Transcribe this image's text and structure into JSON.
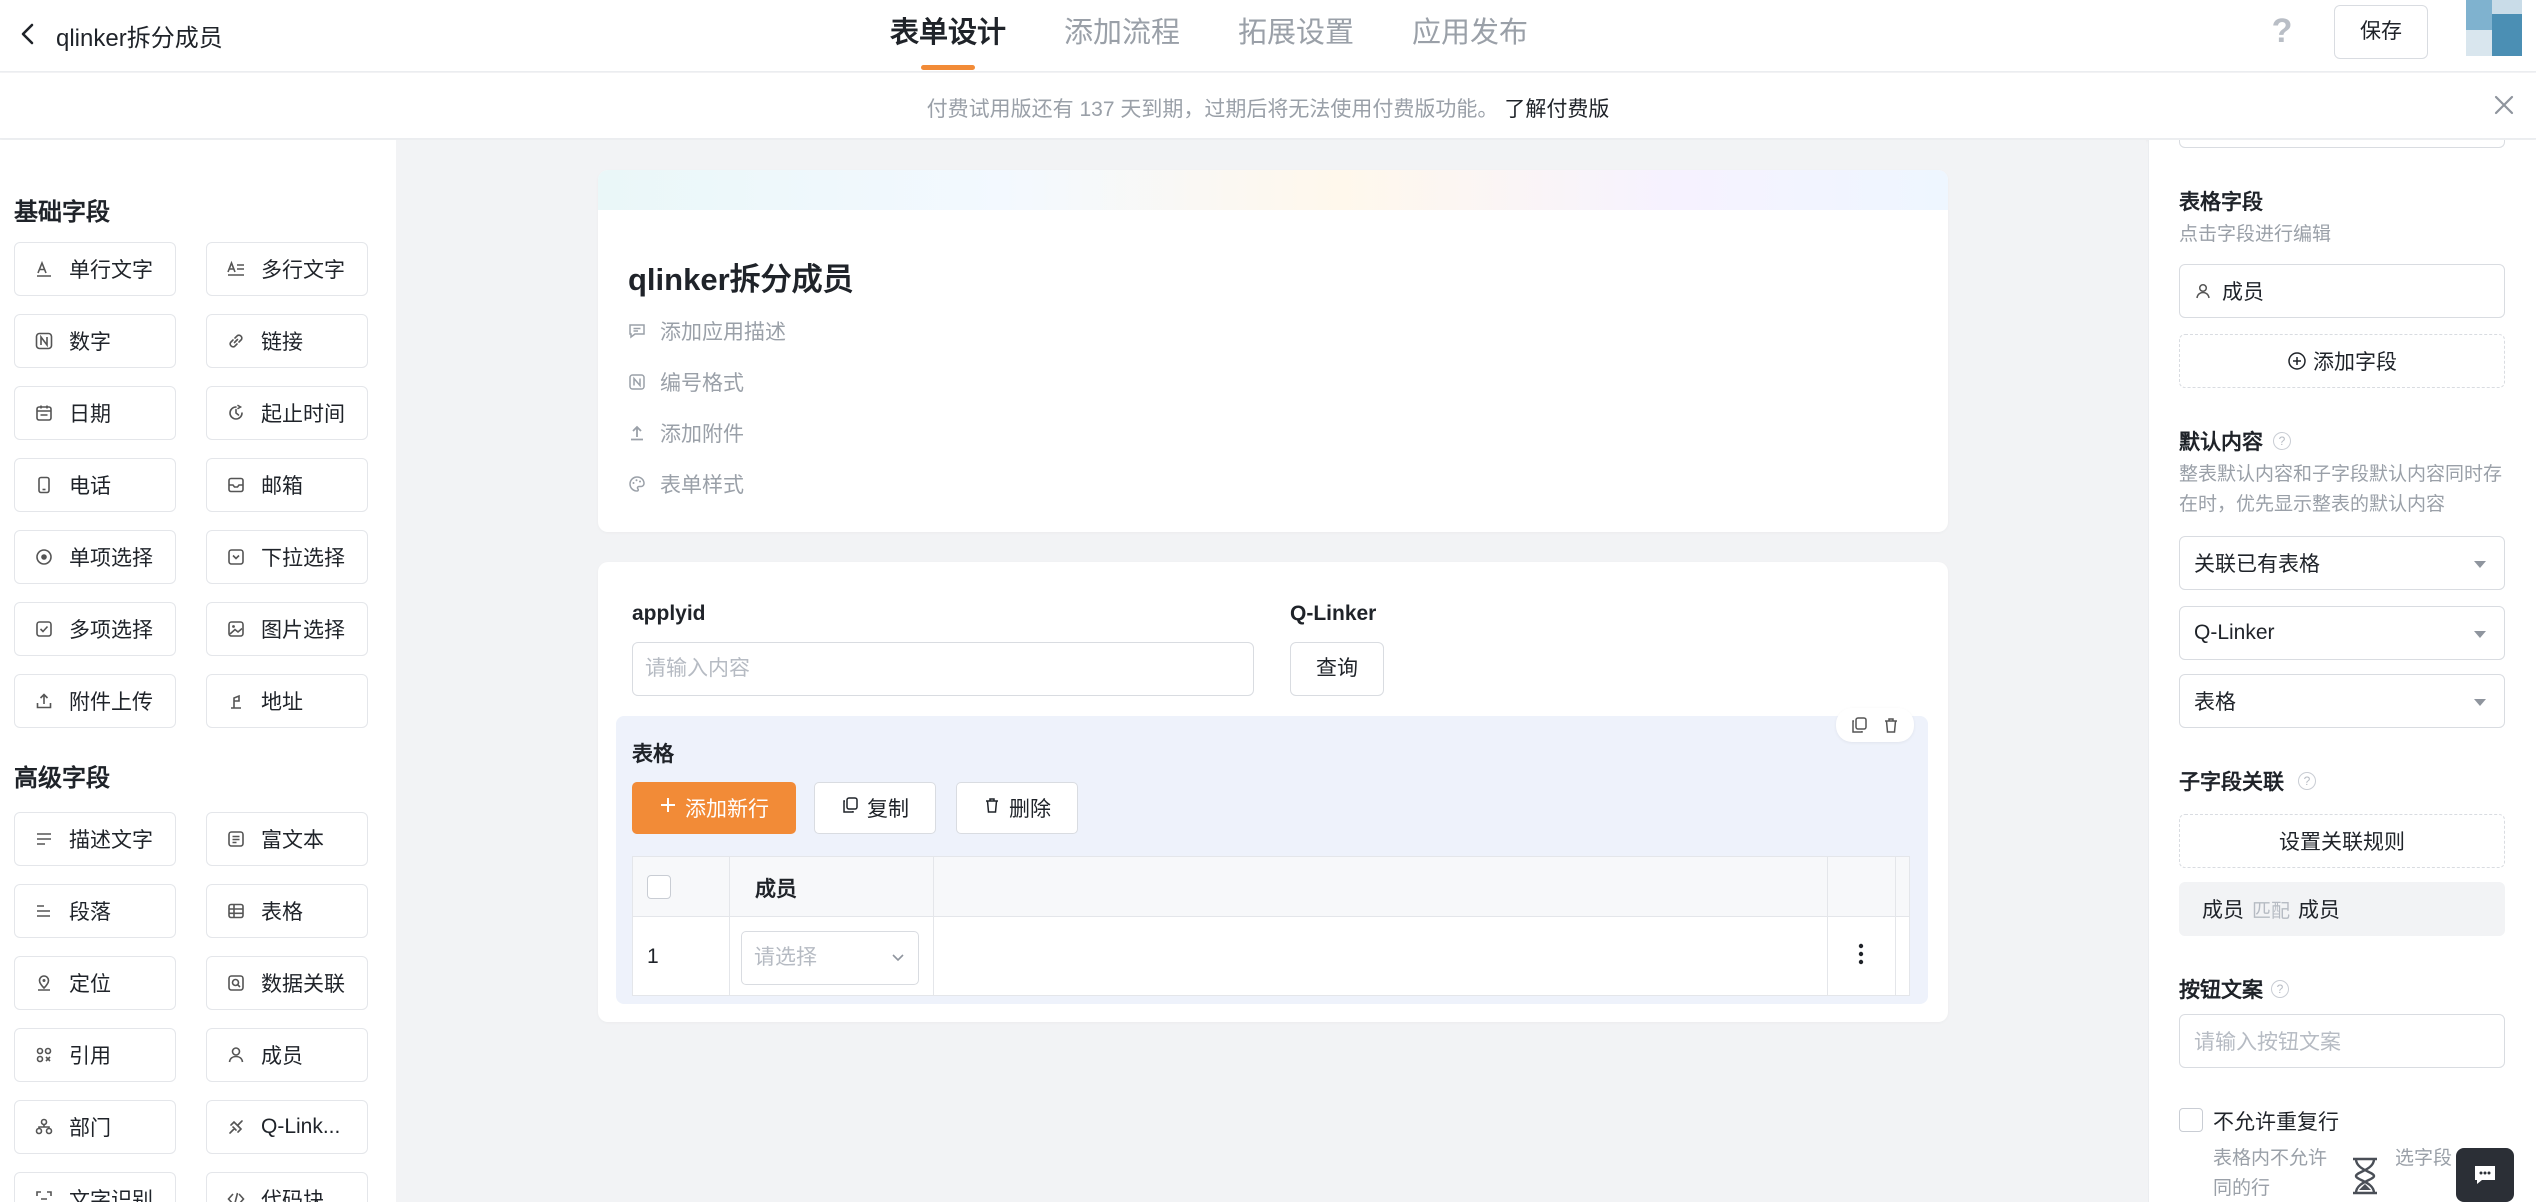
{
  "header": {
    "app_title": "qlinker拆分成员",
    "tabs": [
      {
        "label": "表单设计",
        "active": true
      },
      {
        "label": "添加流程",
        "active": false
      },
      {
        "label": "拓展设置",
        "active": false
      },
      {
        "label": "应用发布",
        "active": false
      }
    ],
    "help_label": "?",
    "save_label": "保存"
  },
  "notice": {
    "text": "付费试用版还有 137 天到期，过期后将无法使用付费版功能。",
    "link": "了解付费版"
  },
  "left_panel": {
    "basic_title": "基础字段",
    "basic_fields": [
      {
        "label": "单行文字",
        "icon": "single-line-text-icon"
      },
      {
        "label": "多行文字",
        "icon": "multi-line-text-icon"
      },
      {
        "label": "数字",
        "icon": "number-icon"
      },
      {
        "label": "链接",
        "icon": "link-icon"
      },
      {
        "label": "日期",
        "icon": "calendar-icon"
      },
      {
        "label": "起止时间",
        "icon": "time-range-icon"
      },
      {
        "label": "电话",
        "icon": "phone-icon"
      },
      {
        "label": "邮箱",
        "icon": "mail-icon"
      },
      {
        "label": "单项选择",
        "icon": "radio-icon"
      },
      {
        "label": "下拉选择",
        "icon": "dropdown-icon"
      },
      {
        "label": "多项选择",
        "icon": "checkbox-icon"
      },
      {
        "label": "图片选择",
        "icon": "image-icon"
      },
      {
        "label": "附件上传",
        "icon": "upload-icon"
      },
      {
        "label": "地址",
        "icon": "location-icon"
      }
    ],
    "advanced_title": "高级字段",
    "advanced_fields": [
      {
        "label": "描述文字",
        "icon": "description-icon"
      },
      {
        "label": "富文本",
        "icon": "rich-text-icon"
      },
      {
        "label": "段落",
        "icon": "paragraph-icon"
      },
      {
        "label": "表格",
        "icon": "table-icon"
      },
      {
        "label": "定位",
        "icon": "pin-icon"
      },
      {
        "label": "数据关联",
        "icon": "data-link-icon"
      },
      {
        "label": "引用",
        "icon": "reference-icon"
      },
      {
        "label": "成员",
        "icon": "member-icon"
      },
      {
        "label": "部门",
        "icon": "department-icon"
      },
      {
        "label": "Q-Link...",
        "icon": "qlinker-icon"
      },
      {
        "label": "文字识别",
        "icon": "ocr-icon"
      },
      {
        "label": "代码块",
        "icon": "code-icon"
      }
    ]
  },
  "form_header": {
    "title": "qlinker拆分成员",
    "meta": [
      {
        "label": "添加应用描述",
        "icon": "comment-icon"
      },
      {
        "label": "编号格式",
        "icon": "number-format-icon"
      },
      {
        "label": "添加附件",
        "icon": "attach-icon"
      },
      {
        "label": "表单样式",
        "icon": "palette-icon"
      }
    ]
  },
  "form_body": {
    "applyid_label": "applyid",
    "applyid_placeholder": "请输入内容",
    "qlinker_label": "Q-Linker",
    "query_button": "查询",
    "table": {
      "title": "表格",
      "add_row": "添加新行",
      "copy": "复制",
      "delete": "删除",
      "column_header": "成员",
      "row_index": "1",
      "select_placeholder": "请选择"
    }
  },
  "right_panel": {
    "table_fields_title": "表格字段",
    "table_fields_sub": "点击字段进行编辑",
    "member_field": "成员",
    "add_field": "添加字段",
    "default_title": "默认内容",
    "default_desc": "整表默认内容和子字段默认内容同时存在时，优先显示整表的默认内容",
    "default_select_1": "关联已有表格",
    "default_select_2": "Q-Linker",
    "default_select_3": "表格",
    "sub_link_title": "子字段关联",
    "set_rule": "设置关联规则",
    "rule_left": "成员",
    "rule_mid": "匹配",
    "rule_right": "成员",
    "button_text_title": "按钮文案",
    "button_text_placeholder": "请输入按钮文案",
    "no_dup_label": "不允许重复行",
    "no_dup_desc_1": "表格内不允许",
    "no_dup_desc_2": "选字段",
    "no_dup_desc_3": "同的行"
  },
  "colors": {
    "accent": "#f28b37",
    "table_bg": "#eef2fb",
    "canvas_bg": "#f2f3f5"
  }
}
